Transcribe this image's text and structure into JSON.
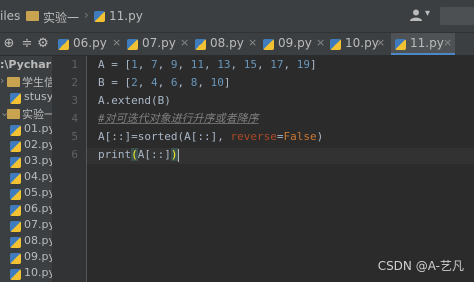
{
  "titlebar": {
    "crumbs": [
      "iles",
      "实验一",
      "11.py"
    ],
    "user_icon": "user-icon",
    "user_chevron": "▾"
  },
  "tabs": [
    {
      "label": "06.py",
      "active": false
    },
    {
      "label": "07.py",
      "active": false
    },
    {
      "label": "08.py",
      "active": false
    },
    {
      "label": "09.py",
      "active": false
    },
    {
      "label": "10.py",
      "active": false
    },
    {
      "label": "11.py",
      "active": true
    }
  ],
  "sidebar": {
    "path": ":\\Pycharm",
    "items": [
      "学生信息系",
      "stusys",
      "实验一",
      "01.py",
      "02.py",
      "03.py",
      "04.py",
      "05.py",
      "06.py",
      "07.py",
      "08.py",
      "09.py",
      "10.py"
    ]
  },
  "editor": {
    "line_numbers": [
      "1",
      "2",
      "3",
      "4",
      "5",
      "6"
    ],
    "lines": {
      "l1": {
        "var": "A",
        "op": " = ",
        "open": "[",
        "nums": [
          "1",
          "7",
          "9",
          "11",
          "13",
          "15",
          "17",
          "19"
        ],
        "close": "]"
      },
      "l2": {
        "var": "B",
        "op": " = ",
        "open": "[",
        "nums": [
          "2",
          "4",
          "6",
          "8",
          "10"
        ],
        "close": "]"
      },
      "l3": "A.extend(B)",
      "l4": "#对可迭代对象进行升序或者降序",
      "l5": {
        "lhs": "A[::]",
        "eq": "=",
        "fn": "sorted",
        "args": "(A[::], ",
        "kw": "reverse",
        "kweq": "=",
        "val": "False",
        "end": ")"
      },
      "l6": {
        "fn": "print",
        "open": "(",
        "arg": "A[::]",
        "close": ")"
      }
    }
  },
  "watermark": "CSDN @A-艺凡"
}
